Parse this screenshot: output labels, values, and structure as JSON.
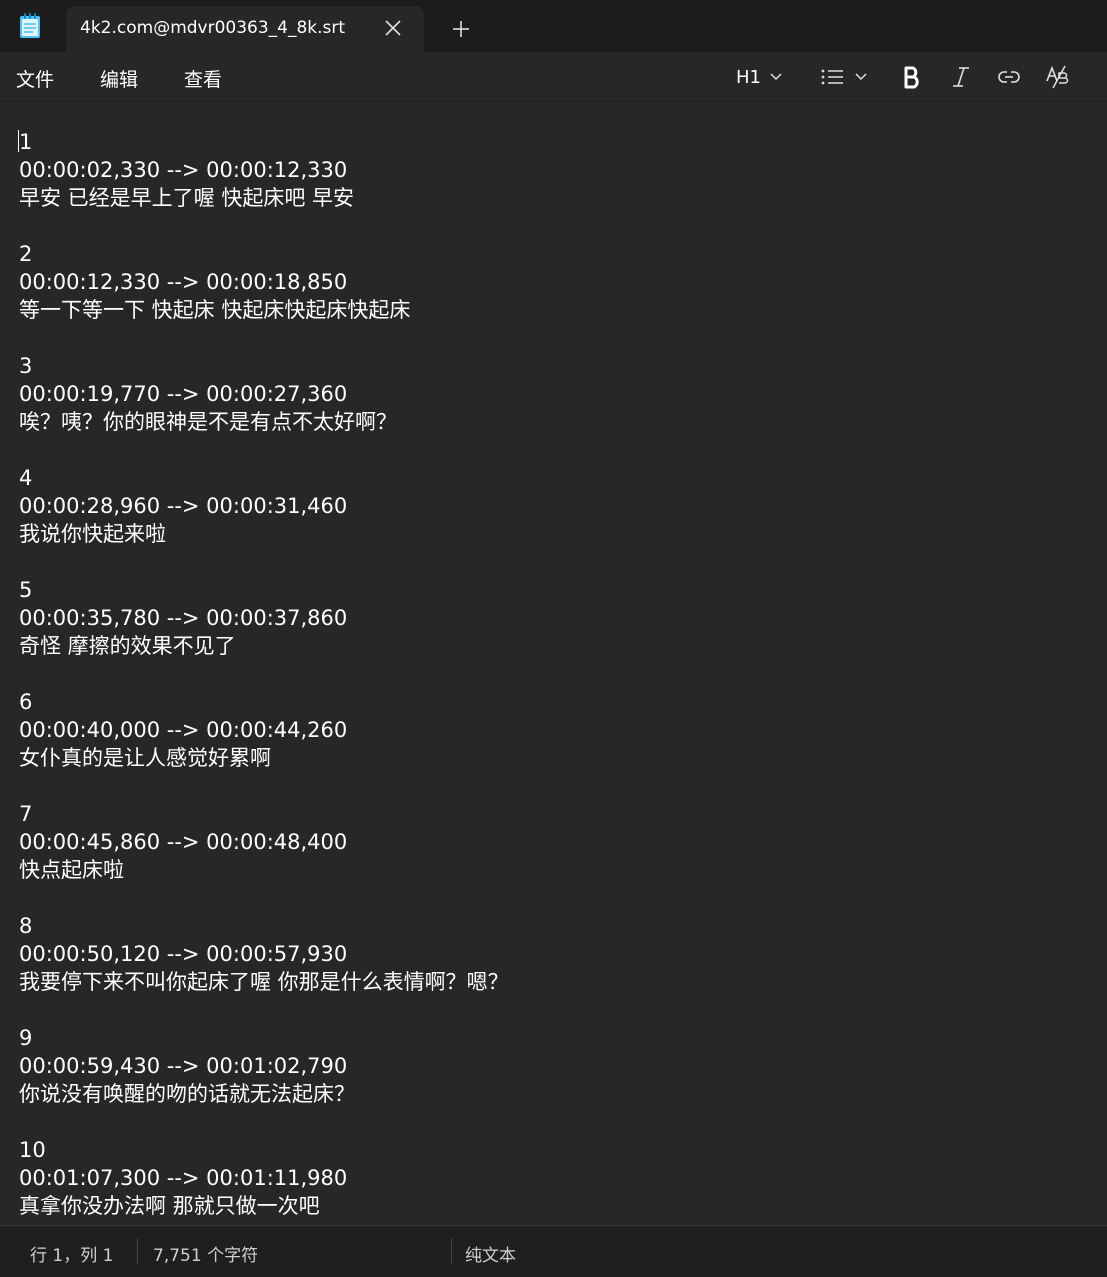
{
  "tab": {
    "title": "4k2.com@mdvr00363_4_8k.srt"
  },
  "menu": {
    "file": "文件",
    "edit": "编辑",
    "view": "查看"
  },
  "toolbar": {
    "heading": "H1"
  },
  "editor": {
    "lines": [
      "1",
      "00:00:02,330 --> 00:00:12,330",
      "早安 已经是早上了喔 快起床吧 早安",
      "",
      "2",
      "00:00:12,330 --> 00:00:18,850",
      "等一下等一下 快起床 快起床快起床快起床",
      "",
      "3",
      "00:00:19,770 --> 00:00:27,360",
      "唉？咦？你的眼神是不是有点不太好啊？",
      "",
      "4",
      "00:00:28,960 --> 00:00:31,460",
      "我说你快起来啦",
      "",
      "5",
      "00:00:35,780 --> 00:00:37,860",
      "奇怪 摩擦的效果不见了",
      "",
      "6",
      "00:00:40,000 --> 00:00:44,260",
      "女仆真的是让人感觉好累啊",
      "",
      "7",
      "00:00:45,860 --> 00:00:48,400",
      "快点起床啦",
      "",
      "8",
      "00:00:50,120 --> 00:00:57,930",
      "我要停下来不叫你起床了喔 你那是什么表情啊？嗯？",
      "",
      "9",
      "00:00:59,430 --> 00:01:02,790",
      "你说没有唤醒的吻的话就无法起床？",
      "",
      "10",
      "00:01:07,300 --> 00:01:11,980",
      "真拿你没办法啊 那就只做一次吧"
    ]
  },
  "status": {
    "position": "行 1，列 1",
    "char_count": "7,751 个字符",
    "format": "纯文本"
  }
}
